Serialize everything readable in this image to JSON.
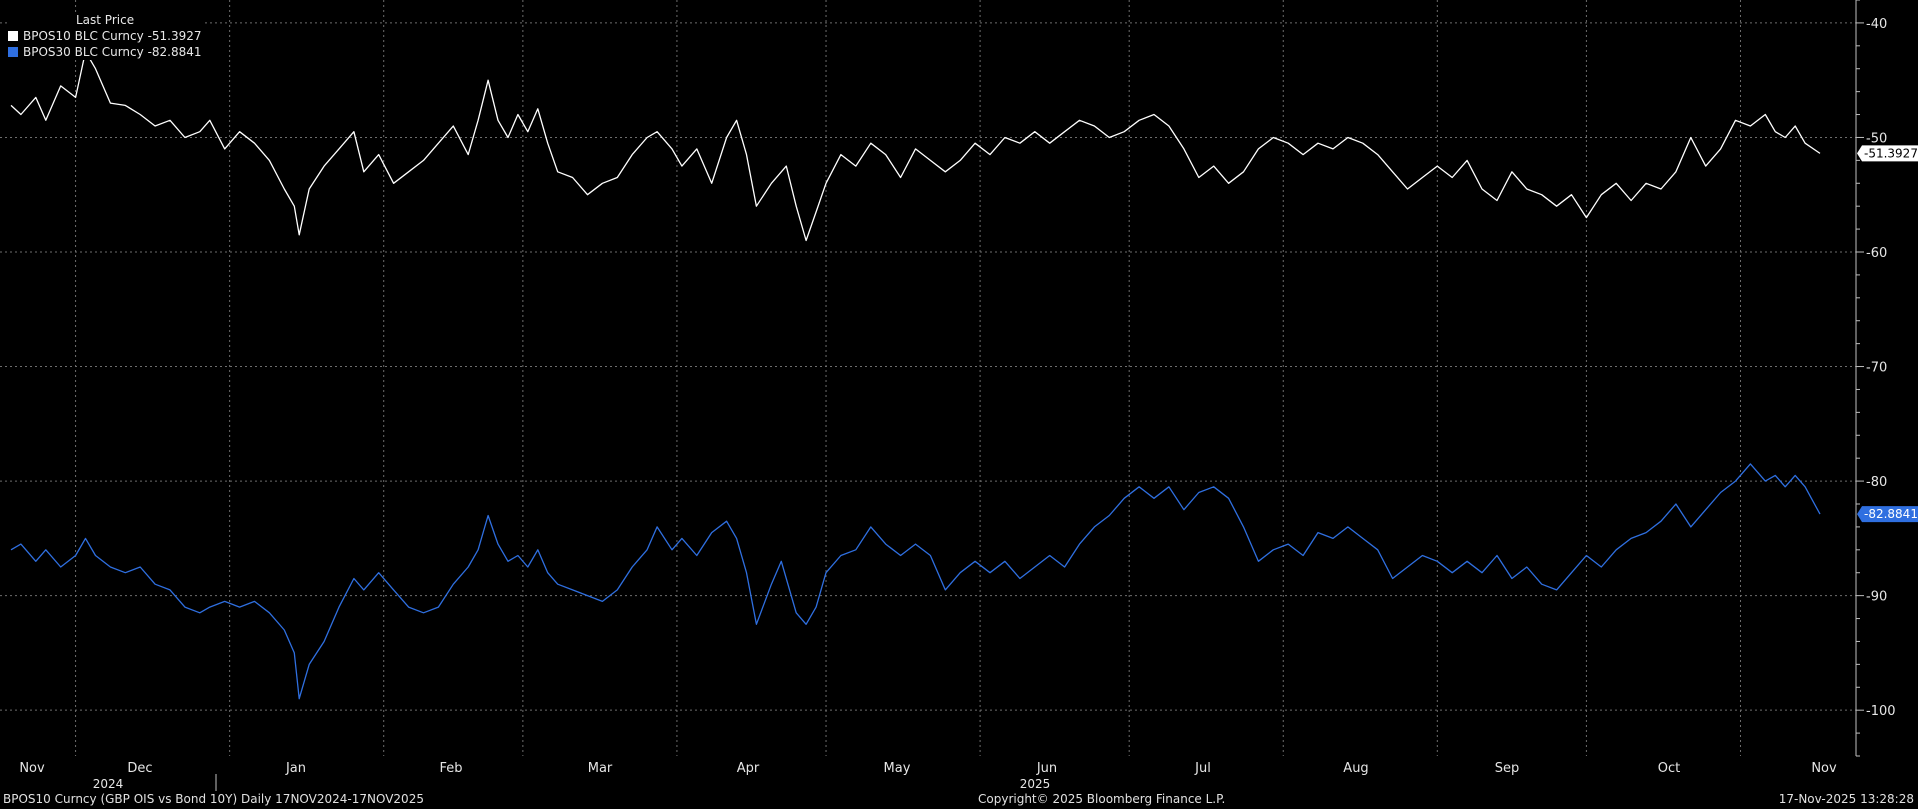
{
  "legend": {
    "header": "Last Price",
    "items": [
      {
        "label": "BPOS10 BLC Curncy",
        "value": "-51.3927",
        "color": "#ffffff"
      },
      {
        "label": "BPOS30 BLC Curncy",
        "value": "-82.8841",
        "color": "#2f6fe0"
      }
    ]
  },
  "footer": {
    "left": "BPOS10 Curncy (GBP OIS vs Bond 10Y) Daily 17NOV2024-17NOV2025",
    "center": "Copyright© 2025 Bloomberg Finance L.P.",
    "right": "17-Nov-2025 13:28:28"
  },
  "chart_data": {
    "type": "line",
    "ylim": [
      -104,
      -38
    ],
    "yticks": [
      -40,
      -50,
      -60,
      -70,
      -80,
      -90,
      -100
    ],
    "grid": true,
    "legend_position": "top-left",
    "x_range": [
      "2024-11-17",
      "2025-11-17"
    ],
    "months": [
      "Nov",
      "Dec",
      "Jan",
      "Feb",
      "Mar",
      "Apr",
      "May",
      "Jun",
      "Jul",
      "Aug",
      "Sep",
      "Oct",
      "Nov"
    ],
    "year_labels": [
      {
        "label": "2024",
        "at": "Dec"
      },
      {
        "label": "2025",
        "at": "Jun"
      }
    ],
    "last_value_labels": [
      {
        "series": "BPOS10 BLC Curncy",
        "text": "-51.3927"
      },
      {
        "series": "BPOS30 BLC Curncy",
        "text": "-82.8841"
      }
    ],
    "series": [
      {
        "name": "BPOS10 BLC Curncy",
        "color": "#ffffff",
        "values": [
          [
            "2024-11-18",
            -47.2
          ],
          [
            "2024-11-20",
            -48.0
          ],
          [
            "2024-11-23",
            -46.5
          ],
          [
            "2024-11-25",
            -48.5
          ],
          [
            "2024-11-28",
            -45.5
          ],
          [
            "2024-12-01",
            -46.5
          ],
          [
            "2024-12-03",
            -42.5
          ],
          [
            "2024-12-05",
            -44.0
          ],
          [
            "2024-12-08",
            -47.0
          ],
          [
            "2024-12-11",
            -47.2
          ],
          [
            "2024-12-14",
            -48.0
          ],
          [
            "2024-12-17",
            -49.0
          ],
          [
            "2024-12-20",
            -48.5
          ],
          [
            "2024-12-23",
            -50.0
          ],
          [
            "2024-12-26",
            -49.5
          ],
          [
            "2024-12-28",
            -48.5
          ],
          [
            "2024-12-31",
            -51.0
          ],
          [
            "2025-01-03",
            -49.5
          ],
          [
            "2025-01-06",
            -50.5
          ],
          [
            "2025-01-09",
            -52.0
          ],
          [
            "2025-01-12",
            -54.5
          ],
          [
            "2025-01-14",
            -56.0
          ],
          [
            "2025-01-15",
            -58.5
          ],
          [
            "2025-01-17",
            -54.5
          ],
          [
            "2025-01-20",
            -52.5
          ],
          [
            "2025-01-23",
            -51.0
          ],
          [
            "2025-01-26",
            -49.5
          ],
          [
            "2025-01-28",
            -53.0
          ],
          [
            "2025-01-31",
            -51.5
          ],
          [
            "2025-02-03",
            -54.0
          ],
          [
            "2025-02-06",
            -53.0
          ],
          [
            "2025-02-09",
            -52.0
          ],
          [
            "2025-02-12",
            -50.5
          ],
          [
            "2025-02-15",
            -49.0
          ],
          [
            "2025-02-18",
            -51.5
          ],
          [
            "2025-02-20",
            -48.5
          ],
          [
            "2025-02-22",
            -45.0
          ],
          [
            "2025-02-24",
            -48.5
          ],
          [
            "2025-02-26",
            -50.0
          ],
          [
            "2025-02-28",
            -48.0
          ],
          [
            "2025-03-02",
            -49.5
          ],
          [
            "2025-03-04",
            -47.5
          ],
          [
            "2025-03-06",
            -50.5
          ],
          [
            "2025-03-08",
            -53.0
          ],
          [
            "2025-03-11",
            -53.5
          ],
          [
            "2025-03-14",
            -55.0
          ],
          [
            "2025-03-17",
            -54.0
          ],
          [
            "2025-03-20",
            -53.5
          ],
          [
            "2025-03-23",
            -51.5
          ],
          [
            "2025-03-26",
            -50.0
          ],
          [
            "2025-03-28",
            -49.5
          ],
          [
            "2025-03-31",
            -51.0
          ],
          [
            "2025-04-02",
            -52.5
          ],
          [
            "2025-04-05",
            -51.0
          ],
          [
            "2025-04-08",
            -54.0
          ],
          [
            "2025-04-11",
            -50.0
          ],
          [
            "2025-04-13",
            -48.5
          ],
          [
            "2025-04-15",
            -51.5
          ],
          [
            "2025-04-17",
            -56.0
          ],
          [
            "2025-04-20",
            -54.0
          ],
          [
            "2025-04-23",
            -52.5
          ],
          [
            "2025-04-25",
            -56.0
          ],
          [
            "2025-04-27",
            -59.0
          ],
          [
            "2025-04-29",
            -56.5
          ],
          [
            "2025-05-01",
            -54.0
          ],
          [
            "2025-05-04",
            -51.5
          ],
          [
            "2025-05-07",
            -52.5
          ],
          [
            "2025-05-10",
            -50.5
          ],
          [
            "2025-05-13",
            -51.5
          ],
          [
            "2025-05-16",
            -53.5
          ],
          [
            "2025-05-19",
            -51.0
          ],
          [
            "2025-05-22",
            -52.0
          ],
          [
            "2025-05-25",
            -53.0
          ],
          [
            "2025-05-28",
            -52.0
          ],
          [
            "2025-05-31",
            -50.5
          ],
          [
            "2025-06-03",
            -51.5
          ],
          [
            "2025-06-06",
            -50.0
          ],
          [
            "2025-06-09",
            -50.5
          ],
          [
            "2025-06-12",
            -49.5
          ],
          [
            "2025-06-15",
            -50.5
          ],
          [
            "2025-06-18",
            -49.5
          ],
          [
            "2025-06-21",
            -48.5
          ],
          [
            "2025-06-24",
            -49.0
          ],
          [
            "2025-06-27",
            -50.0
          ],
          [
            "2025-06-30",
            -49.5
          ],
          [
            "2025-07-03",
            -48.5
          ],
          [
            "2025-07-06",
            -48.0
          ],
          [
            "2025-07-09",
            -49.0
          ],
          [
            "2025-07-12",
            -51.0
          ],
          [
            "2025-07-15",
            -53.5
          ],
          [
            "2025-07-18",
            -52.5
          ],
          [
            "2025-07-21",
            -54.0
          ],
          [
            "2025-07-24",
            -53.0
          ],
          [
            "2025-07-27",
            -51.0
          ],
          [
            "2025-07-30",
            -50.0
          ],
          [
            "2025-08-02",
            -50.5
          ],
          [
            "2025-08-05",
            -51.5
          ],
          [
            "2025-08-08",
            -50.5
          ],
          [
            "2025-08-11",
            -51.0
          ],
          [
            "2025-08-14",
            -50.0
          ],
          [
            "2025-08-17",
            -50.5
          ],
          [
            "2025-08-20",
            -51.5
          ],
          [
            "2025-08-23",
            -53.0
          ],
          [
            "2025-08-26",
            -54.5
          ],
          [
            "2025-08-29",
            -53.5
          ],
          [
            "2025-09-01",
            -52.5
          ],
          [
            "2025-09-04",
            -53.5
          ],
          [
            "2025-09-07",
            -52.0
          ],
          [
            "2025-09-10",
            -54.5
          ],
          [
            "2025-09-13",
            -55.5
          ],
          [
            "2025-09-16",
            -53.0
          ],
          [
            "2025-09-19",
            -54.5
          ],
          [
            "2025-09-22",
            -55.0
          ],
          [
            "2025-09-25",
            -56.0
          ],
          [
            "2025-09-28",
            -55.0
          ],
          [
            "2025-10-01",
            -57.0
          ],
          [
            "2025-10-04",
            -55.0
          ],
          [
            "2025-10-07",
            -54.0
          ],
          [
            "2025-10-10",
            -55.5
          ],
          [
            "2025-10-13",
            -54.0
          ],
          [
            "2025-10-16",
            -54.5
          ],
          [
            "2025-10-19",
            -53.0
          ],
          [
            "2025-10-22",
            -50.0
          ],
          [
            "2025-10-25",
            -52.5
          ],
          [
            "2025-10-28",
            -51.0
          ],
          [
            "2025-10-31",
            -48.5
          ],
          [
            "2025-11-03",
            -49.0
          ],
          [
            "2025-11-06",
            -48.0
          ],
          [
            "2025-11-08",
            -49.5
          ],
          [
            "2025-11-10",
            -50.0
          ],
          [
            "2025-11-12",
            -49.0
          ],
          [
            "2025-11-14",
            -50.5
          ],
          [
            "2025-11-17",
            -51.3927
          ]
        ]
      },
      {
        "name": "BPOS30 BLC Curncy",
        "color": "#2f6fe0",
        "values": [
          [
            "2024-11-18",
            -86.0
          ],
          [
            "2024-11-20",
            -85.5
          ],
          [
            "2024-11-23",
            -87.0
          ],
          [
            "2024-11-25",
            -86.0
          ],
          [
            "2024-11-28",
            -87.5
          ],
          [
            "2024-12-01",
            -86.5
          ],
          [
            "2024-12-03",
            -85.0
          ],
          [
            "2024-12-05",
            -86.5
          ],
          [
            "2024-12-08",
            -87.5
          ],
          [
            "2024-12-11",
            -88.0
          ],
          [
            "2024-12-14",
            -87.5
          ],
          [
            "2024-12-17",
            -89.0
          ],
          [
            "2024-12-20",
            -89.5
          ],
          [
            "2024-12-23",
            -91.0
          ],
          [
            "2024-12-26",
            -91.5
          ],
          [
            "2024-12-28",
            -91.0
          ],
          [
            "2024-12-31",
            -90.5
          ],
          [
            "2025-01-03",
            -91.0
          ],
          [
            "2025-01-06",
            -90.5
          ],
          [
            "2025-01-09",
            -91.5
          ],
          [
            "2025-01-12",
            -93.0
          ],
          [
            "2025-01-14",
            -95.0
          ],
          [
            "2025-01-15",
            -99.0
          ],
          [
            "2025-01-17",
            -96.0
          ],
          [
            "2025-01-20",
            -94.0
          ],
          [
            "2025-01-23",
            -91.0
          ],
          [
            "2025-01-26",
            -88.5
          ],
          [
            "2025-01-28",
            -89.5
          ],
          [
            "2025-01-31",
            -88.0
          ],
          [
            "2025-02-03",
            -89.5
          ],
          [
            "2025-02-06",
            -91.0
          ],
          [
            "2025-02-09",
            -91.5
          ],
          [
            "2025-02-12",
            -91.0
          ],
          [
            "2025-02-15",
            -89.0
          ],
          [
            "2025-02-18",
            -87.5
          ],
          [
            "2025-02-20",
            -86.0
          ],
          [
            "2025-02-22",
            -83.0
          ],
          [
            "2025-02-24",
            -85.5
          ],
          [
            "2025-02-26",
            -87.0
          ],
          [
            "2025-02-28",
            -86.5
          ],
          [
            "2025-03-02",
            -87.5
          ],
          [
            "2025-03-04",
            -86.0
          ],
          [
            "2025-03-06",
            -88.0
          ],
          [
            "2025-03-08",
            -89.0
          ],
          [
            "2025-03-11",
            -89.5
          ],
          [
            "2025-03-14",
            -90.0
          ],
          [
            "2025-03-17",
            -90.5
          ],
          [
            "2025-03-20",
            -89.5
          ],
          [
            "2025-03-23",
            -87.5
          ],
          [
            "2025-03-26",
            -86.0
          ],
          [
            "2025-03-28",
            -84.0
          ],
          [
            "2025-03-31",
            -86.0
          ],
          [
            "2025-04-02",
            -85.0
          ],
          [
            "2025-04-05",
            -86.5
          ],
          [
            "2025-04-08",
            -84.5
          ],
          [
            "2025-04-11",
            -83.5
          ],
          [
            "2025-04-13",
            -85.0
          ],
          [
            "2025-04-15",
            -88.0
          ],
          [
            "2025-04-17",
            -92.5
          ],
          [
            "2025-04-20",
            -89.0
          ],
          [
            "2025-04-22",
            -87.0
          ],
          [
            "2025-04-25",
            -91.5
          ],
          [
            "2025-04-27",
            -92.5
          ],
          [
            "2025-04-29",
            -91.0
          ],
          [
            "2025-05-01",
            -88.0
          ],
          [
            "2025-05-04",
            -86.5
          ],
          [
            "2025-05-07",
            -86.0
          ],
          [
            "2025-05-10",
            -84.0
          ],
          [
            "2025-05-13",
            -85.5
          ],
          [
            "2025-05-16",
            -86.5
          ],
          [
            "2025-05-19",
            -85.5
          ],
          [
            "2025-05-22",
            -86.5
          ],
          [
            "2025-05-25",
            -89.5
          ],
          [
            "2025-05-28",
            -88.0
          ],
          [
            "2025-05-31",
            -87.0
          ],
          [
            "2025-06-03",
            -88.0
          ],
          [
            "2025-06-06",
            -87.0
          ],
          [
            "2025-06-09",
            -88.5
          ],
          [
            "2025-06-12",
            -87.5
          ],
          [
            "2025-06-15",
            -86.5
          ],
          [
            "2025-06-18",
            -87.5
          ],
          [
            "2025-06-21",
            -85.5
          ],
          [
            "2025-06-24",
            -84.0
          ],
          [
            "2025-06-27",
            -83.0
          ],
          [
            "2025-06-30",
            -81.5
          ],
          [
            "2025-07-03",
            -80.5
          ],
          [
            "2025-07-06",
            -81.5
          ],
          [
            "2025-07-09",
            -80.5
          ],
          [
            "2025-07-12",
            -82.5
          ],
          [
            "2025-07-15",
            -81.0
          ],
          [
            "2025-07-18",
            -80.5
          ],
          [
            "2025-07-21",
            -81.5
          ],
          [
            "2025-07-24",
            -84.0
          ],
          [
            "2025-07-27",
            -87.0
          ],
          [
            "2025-07-30",
            -86.0
          ],
          [
            "2025-08-02",
            -85.5
          ],
          [
            "2025-08-05",
            -86.5
          ],
          [
            "2025-08-08",
            -84.5
          ],
          [
            "2025-08-11",
            -85.0
          ],
          [
            "2025-08-14",
            -84.0
          ],
          [
            "2025-08-17",
            -85.0
          ],
          [
            "2025-08-20",
            -86.0
          ],
          [
            "2025-08-23",
            -88.5
          ],
          [
            "2025-08-26",
            -87.5
          ],
          [
            "2025-08-29",
            -86.5
          ],
          [
            "2025-09-01",
            -87.0
          ],
          [
            "2025-09-04",
            -88.0
          ],
          [
            "2025-09-07",
            -87.0
          ],
          [
            "2025-09-10",
            -88.0
          ],
          [
            "2025-09-13",
            -86.5
          ],
          [
            "2025-09-16",
            -88.5
          ],
          [
            "2025-09-19",
            -87.5
          ],
          [
            "2025-09-22",
            -89.0
          ],
          [
            "2025-09-25",
            -89.5
          ],
          [
            "2025-09-28",
            -88.0
          ],
          [
            "2025-10-01",
            -86.5
          ],
          [
            "2025-10-04",
            -87.5
          ],
          [
            "2025-10-07",
            -86.0
          ],
          [
            "2025-10-10",
            -85.0
          ],
          [
            "2025-10-13",
            -84.5
          ],
          [
            "2025-10-16",
            -83.5
          ],
          [
            "2025-10-19",
            -82.0
          ],
          [
            "2025-10-22",
            -84.0
          ],
          [
            "2025-10-25",
            -82.5
          ],
          [
            "2025-10-28",
            -81.0
          ],
          [
            "2025-10-31",
            -80.0
          ],
          [
            "2025-11-03",
            -78.5
          ],
          [
            "2025-11-06",
            -80.0
          ],
          [
            "2025-11-08",
            -79.5
          ],
          [
            "2025-11-10",
            -80.5
          ],
          [
            "2025-11-12",
            -79.5
          ],
          [
            "2025-11-14",
            -80.5
          ],
          [
            "2025-11-17",
            -82.8841
          ]
        ]
      }
    ]
  }
}
